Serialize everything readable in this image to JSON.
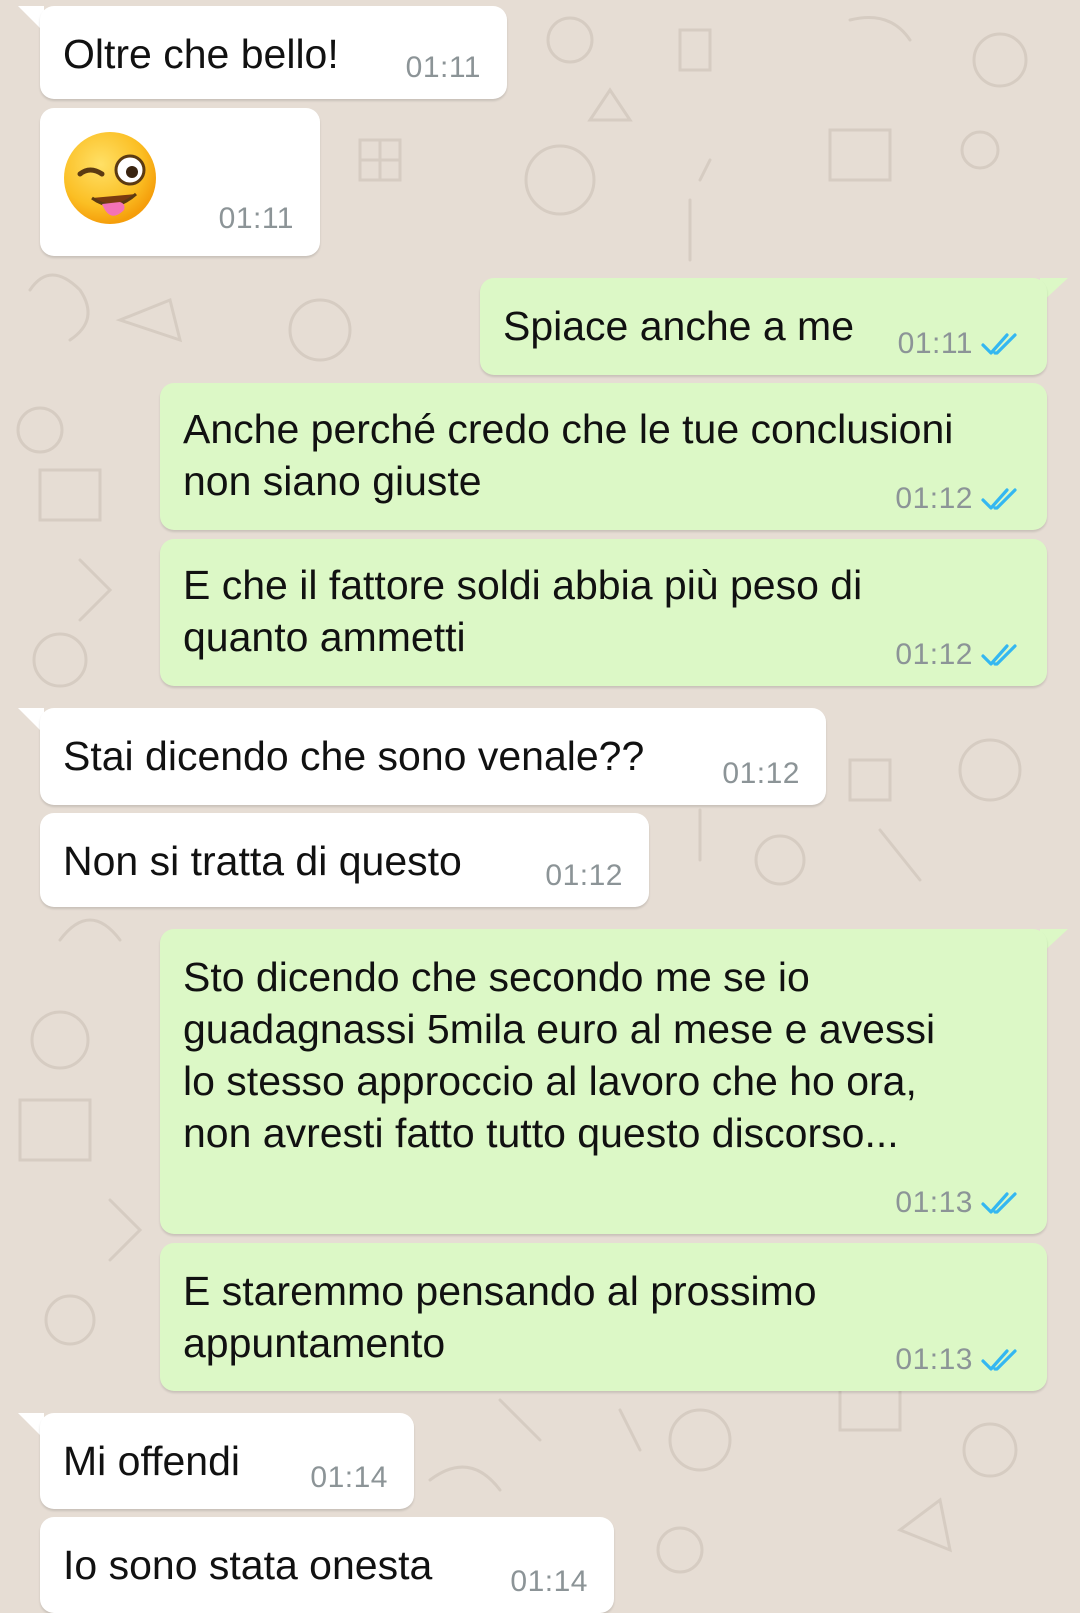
{
  "colors": {
    "chat_background": "#e6ddd4",
    "incoming_bubble": "#ffffff",
    "outgoing_bubble": "#dcf8c6",
    "timestamp": "#8c9497",
    "read_ticks": "#34b7f1"
  },
  "messages": [
    {
      "direction": "in",
      "text": "Oltre che bello!",
      "time": "01:11"
    },
    {
      "direction": "in",
      "emoji": "winking-face-with-tongue",
      "time": "01:11"
    },
    {
      "direction": "out",
      "text": "Spiace anche a me",
      "time": "01:11",
      "status": "read"
    },
    {
      "direction": "out",
      "text": "Anche perché credo che le tue conclusioni\nnon siano giuste",
      "time": "01:12",
      "status": "read"
    },
    {
      "direction": "out",
      "text": "E che il fattore soldi abbia più peso di\nquanto ammetti",
      "time": "01:12",
      "status": "read"
    },
    {
      "direction": "in",
      "text": "Stai dicendo che sono venale??",
      "time": "01:12"
    },
    {
      "direction": "in",
      "text": "Non si tratta di questo",
      "time": "01:12"
    },
    {
      "direction": "out",
      "text": "Sto dicendo che secondo me se io\nguadagnassi 5mila euro al mese e avessi\nlo stesso approccio al lavoro che ho ora,\nnon avresti fatto tutto questo discorso...",
      "time": "01:13",
      "status": "read"
    },
    {
      "direction": "out",
      "text": "E staremmo pensando al prossimo\nappuntamento",
      "time": "01:13",
      "status": "read"
    },
    {
      "direction": "in",
      "text": "Mi offendi",
      "time": "01:14"
    },
    {
      "direction": "in",
      "text": "Io sono stata onesta",
      "time": "01:14"
    }
  ]
}
